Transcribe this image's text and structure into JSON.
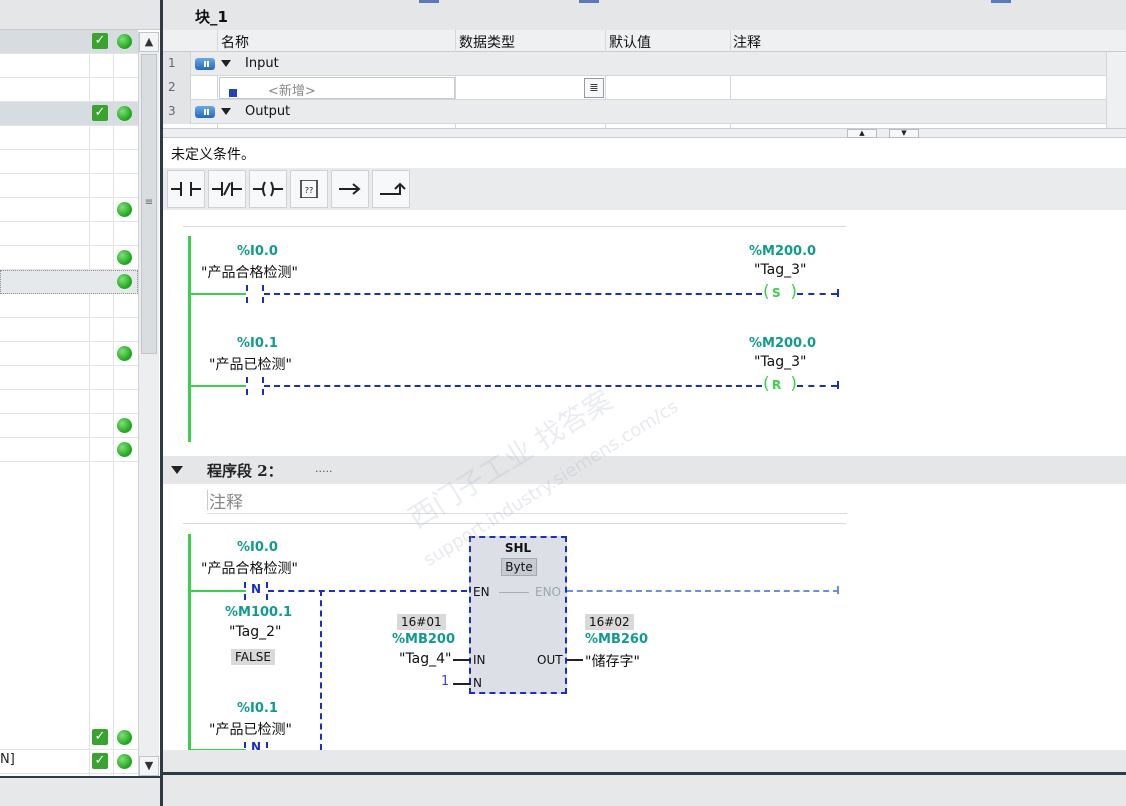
{
  "left": {
    "bottom_row_text": "N]",
    "scroll_up": "▲",
    "scroll_down": "▼",
    "scroll_grip": "≡"
  },
  "block": {
    "title": "块_1"
  },
  "interface": {
    "columns": [
      "名称",
      "数据类型",
      "默认值",
      "注释"
    ],
    "rows": [
      {
        "num": "1",
        "label": "Input"
      },
      {
        "num": "2",
        "placeholder": "<新增>"
      },
      {
        "num": "3",
        "label": "Output"
      }
    ]
  },
  "editor": {
    "condition_text": "未定义条件。",
    "palette": [
      {
        "name": "no-contact"
      },
      {
        "name": "nc-contact"
      },
      {
        "name": "coil"
      },
      {
        "name": "empty-box",
        "label": "??"
      },
      {
        "name": "open-branch"
      },
      {
        "name": "close-branch"
      }
    ],
    "network1": {
      "rung1": {
        "contact_addr": "%I0.0",
        "contact_tag": "\"产品合格检测\"",
        "coil_addr": "%M200.0",
        "coil_tag": "\"Tag_3\"",
        "coil_type": "S"
      },
      "rung2": {
        "contact_addr": "%I0.1",
        "contact_tag": "\"产品已检测\"",
        "coil_addr": "%M200.0",
        "coil_tag": "\"Tag_3\"",
        "coil_type": "R"
      }
    },
    "segment2": {
      "title": "程序段 2：",
      "dots": ".....",
      "comment": "注释"
    },
    "network2": {
      "contact1_addr": "%I0.0",
      "contact1_tag": "\"产品合格检测\"",
      "edge1_label": "N",
      "edge1_mem_addr": "%M100.1",
      "edge1_mem_tag": "\"Tag_2\"",
      "edge1_mem_value": "FALSE",
      "contact2_addr": "%I0.1",
      "contact2_tag": "\"产品已检测\"",
      "edge2_label": "N",
      "shl": {
        "name": "SHL",
        "type": "Byte",
        "en": "EN",
        "eno": "ENO",
        "in": "IN",
        "out": "OUT",
        "n": "N",
        "in_value": "16#01",
        "in_addr": "%MB200",
        "in_tag": "\"Tag_4\"",
        "n_value": "1",
        "out_value": "16#02",
        "out_addr": "%MB260",
        "out_tag": "\"储存字\""
      }
    },
    "watermark": "西门子工业  找答案",
    "watermark_url": "support.industry.siemens.com/cs"
  },
  "colors": {
    "power_flow": "#3ad14a",
    "no_flow": "#1a2fbf",
    "address": "#119a8e"
  }
}
